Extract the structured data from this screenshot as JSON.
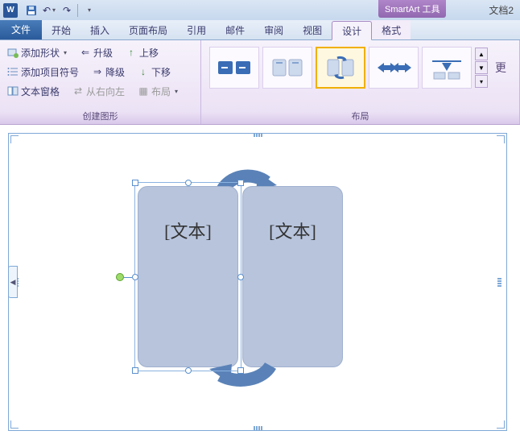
{
  "titlebar": {
    "app_letter": "W",
    "doc_title": "文档2",
    "context_title": "SmartArt 工具"
  },
  "tabs": {
    "file": "文件",
    "home": "开始",
    "insert": "插入",
    "page_layout": "页面布局",
    "references": "引用",
    "mailings": "邮件",
    "review": "审阅",
    "view": "视图",
    "design": "设计",
    "format": "格式"
  },
  "ribbon": {
    "create_group": "创建图形",
    "layout_group": "布局",
    "add_shape": "添加形状",
    "add_bullet": "添加项目符号",
    "text_pane": "文本窗格",
    "promote": "升级",
    "demote": "降级",
    "rtl": "从右向左",
    "move_up": "上移",
    "move_down": "下移",
    "layout_btn": "布局",
    "more": "更"
  },
  "diagram": {
    "placeholder": "[文本]"
  }
}
